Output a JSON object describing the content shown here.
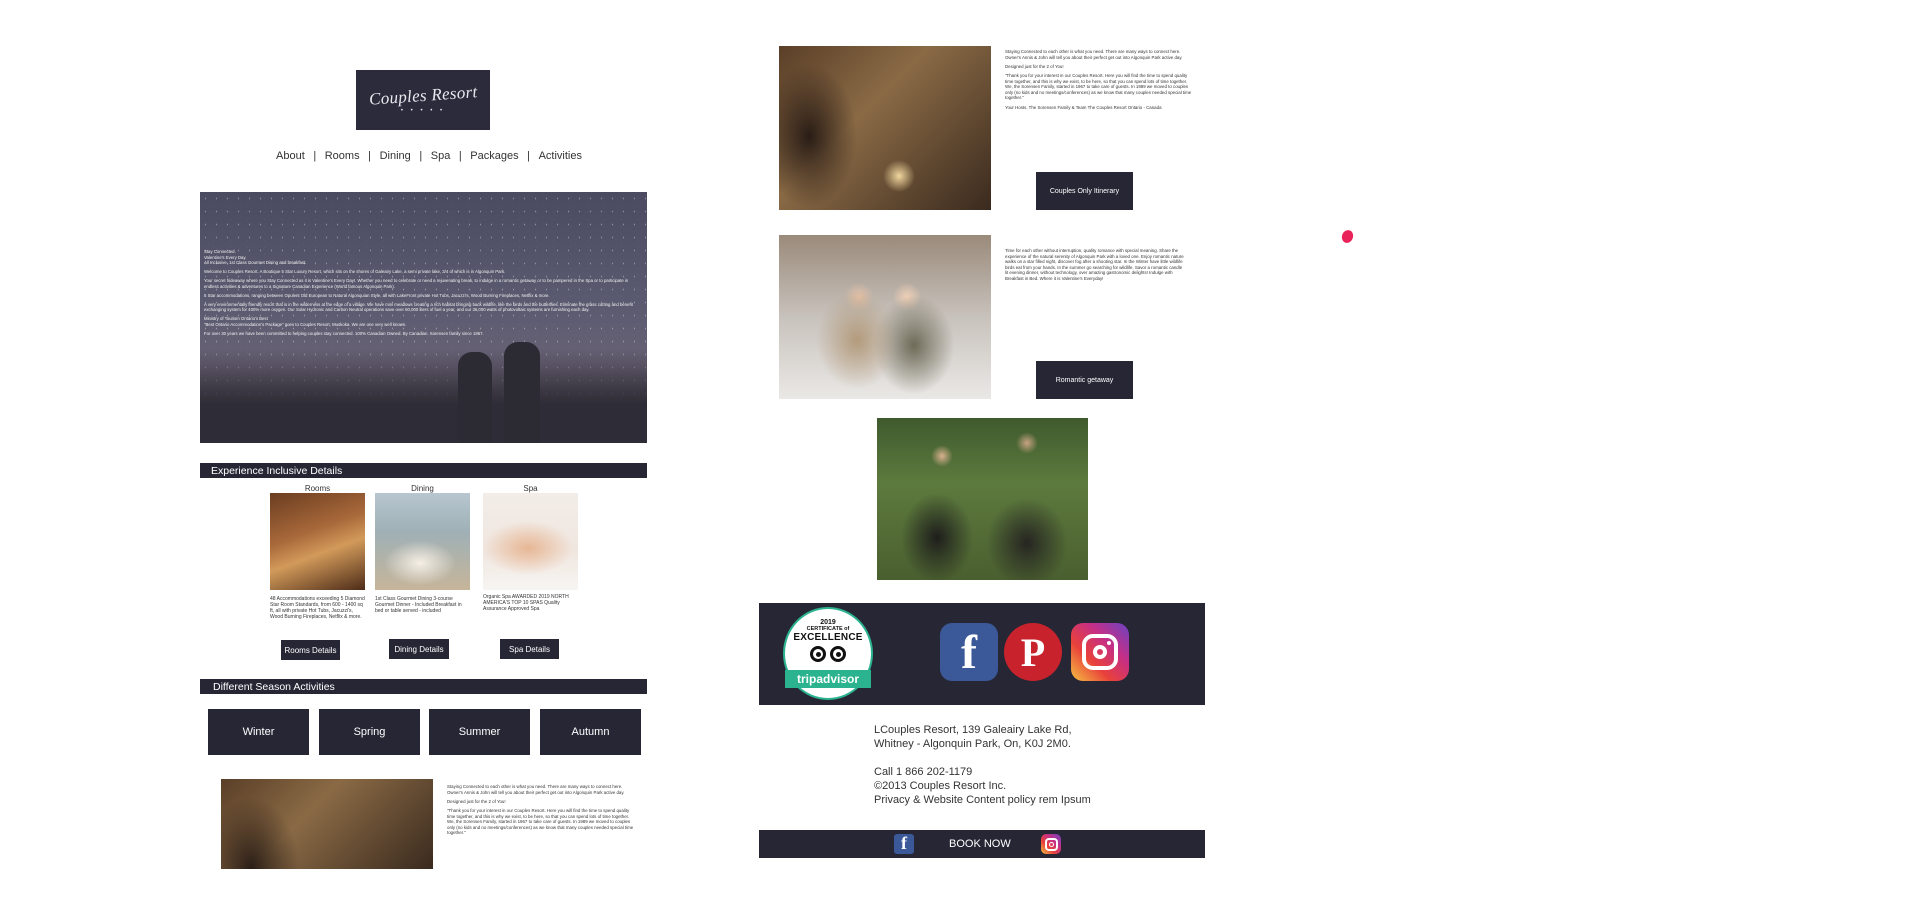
{
  "logo": {
    "text": "Couples Resort",
    "dots": "• • • • •"
  },
  "nav": {
    "items": [
      "About",
      "Rooms",
      "Dining",
      "Spa",
      "Packages",
      "Activities"
    ],
    "separator": "|"
  },
  "hero": {
    "lines": [
      "Stay Connected.",
      "Valentine's Every Day.",
      "All Inclusive, 1st Class Gourmet Dining and breakfast.",
      "Welcome to Couples Resort. A Boutique 5 Star Luxury Resort, which sits on the shores of Galeairy Lake, a semi private lake, 3/4 of which is in Algonquin Park.",
      "Your secret hideaway where you Stay Connected as it is Valentine's Every Day!. Whether you need to celebrate or need a rejuvenating break, to indulge in a romantic getaway or to be pampered in the Spa or to participate in endless activities & adventures to a Signature Canadian Experience (World famous Algonquin Park).",
      "5 Star accommodations, ranging between Opulent Old European to Natural Algonquian Style, all with LakeFront private Hot Tubs, Jacuzzi's, Wood Burning Fireplaces, Netflix & more.",
      "A very environmentally friendly resort that is in the wilderness at the edge of a village. We have mini meadows creating a rich habitat bringing back wildlife, like the birds and the butterflies. Eliminate the grass cutting and benefit exchanging system for 400% more oxygen. Our Solar Hydronic and Carbon Neutral operations save over 60,000 liters of fuel a year, and our 36,000 watts of photovoltaic systems are furnishing each day.",
      "Ministry of Tourism Ontario's Best",
      "\"Best Ontario Accommodation's Package\" goes to Couples Resort, Muskoka. We are one very well known.",
      "For over 30 years we have been committed to helping couples stay connected. 100% Canadian Owned. By Canadian. Sorensen family since 1967."
    ]
  },
  "experience": {
    "title": "Experience Inclusive Details",
    "tiles": [
      {
        "label": "Rooms",
        "desc": "48 Accommodations exceeding 5 Diamond Star Room Standards, from 600 - 1400 sq ft, all with private Hot Tubs, Jacuzzi's, Wood Burning Fireplaces, Netflix & more.",
        "button": "Rooms Details",
        "image": "rooms-photo"
      },
      {
        "label": "Dining",
        "desc": "1st Class Gourmet Dining 3-course Gourmet Dinner - Included Breakfast in bed or table served - included",
        "button": "Dining Details",
        "image": "dining-photo"
      },
      {
        "label": "Spa",
        "desc": "Organic Spa AWARDED 2019 NORTH AMERICA'S TOP 10 SPAS Quality Assurance Approved Spa",
        "button": "Spa Details",
        "image": "spa-photo"
      }
    ]
  },
  "seasons": {
    "title": "Different Season Activities",
    "items": [
      "Winter",
      "Spring",
      "Summer",
      "Autumn"
    ]
  },
  "story": {
    "paragraphs": [
      "Staying Connected to each other is what you need. There are many ways to connect here. Owner's Annis & John will tell you about their perfect get out into Algonquin Park active day.",
      "Designed just for the 2 of You!",
      "\"Thank you for your interest in our Couples Resort. Here you will find the time to spend quality time together, and this is why we exist, to be here, so that you can spend lots of time together. We, the Sorensen Family, started in 1967 to take care of guests. In 1989 we moved to couples only (no kids and no meetings/conferences) as we know that many couples needed special time together.\"",
      "Your Hosts, The Sorensen Family & Team The Couples Resort Ontario - Canada"
    ],
    "button": "Couples Only Itinerary"
  },
  "romance": {
    "text": "Time for each other without interruption, quality romance with special meaning. Share the experience of the natural serenity of Algonquin Park with a loved one. Enjoy romantic nature walks on a star filled night, discover fog after a shooting star. In the Winter have little wildlife birds eat from your hands. In the summer go searching for wildlife. Savor a romantic candle lit evening dinner, without technology, over amazing gastronomic delights! Indulge with Breakfast in Bed. Where it is Valentine's Everyday!",
    "button": "Romantic getaway"
  },
  "tripadvisor": {
    "year": "2019",
    "line1": "CERTIFICATE of",
    "line2": "EXCELLENCE",
    "brand": "tripadvisor"
  },
  "social": {
    "facebook_glyph": "f",
    "pinterest_glyph": "P",
    "facebook_color": "#3b5998",
    "pinterest_color": "#c8232c",
    "instagram_color": "#d6336c"
  },
  "footer": {
    "address_line1": "LCouples Resort, 139 Galeairy Lake Rd,",
    "address_line2": "Whitney - Algonquin Park, On, K0J 2M0.",
    "phone": "Call 1 866 202-1179",
    "copyright": "©2013 Couples Resort Inc.",
    "policy": "Privacy & Website Content policy rem Ipsum",
    "book_now": "BOOK NOW"
  },
  "colors": {
    "navy": "#272635",
    "cursor_marker": "#e8245a"
  }
}
